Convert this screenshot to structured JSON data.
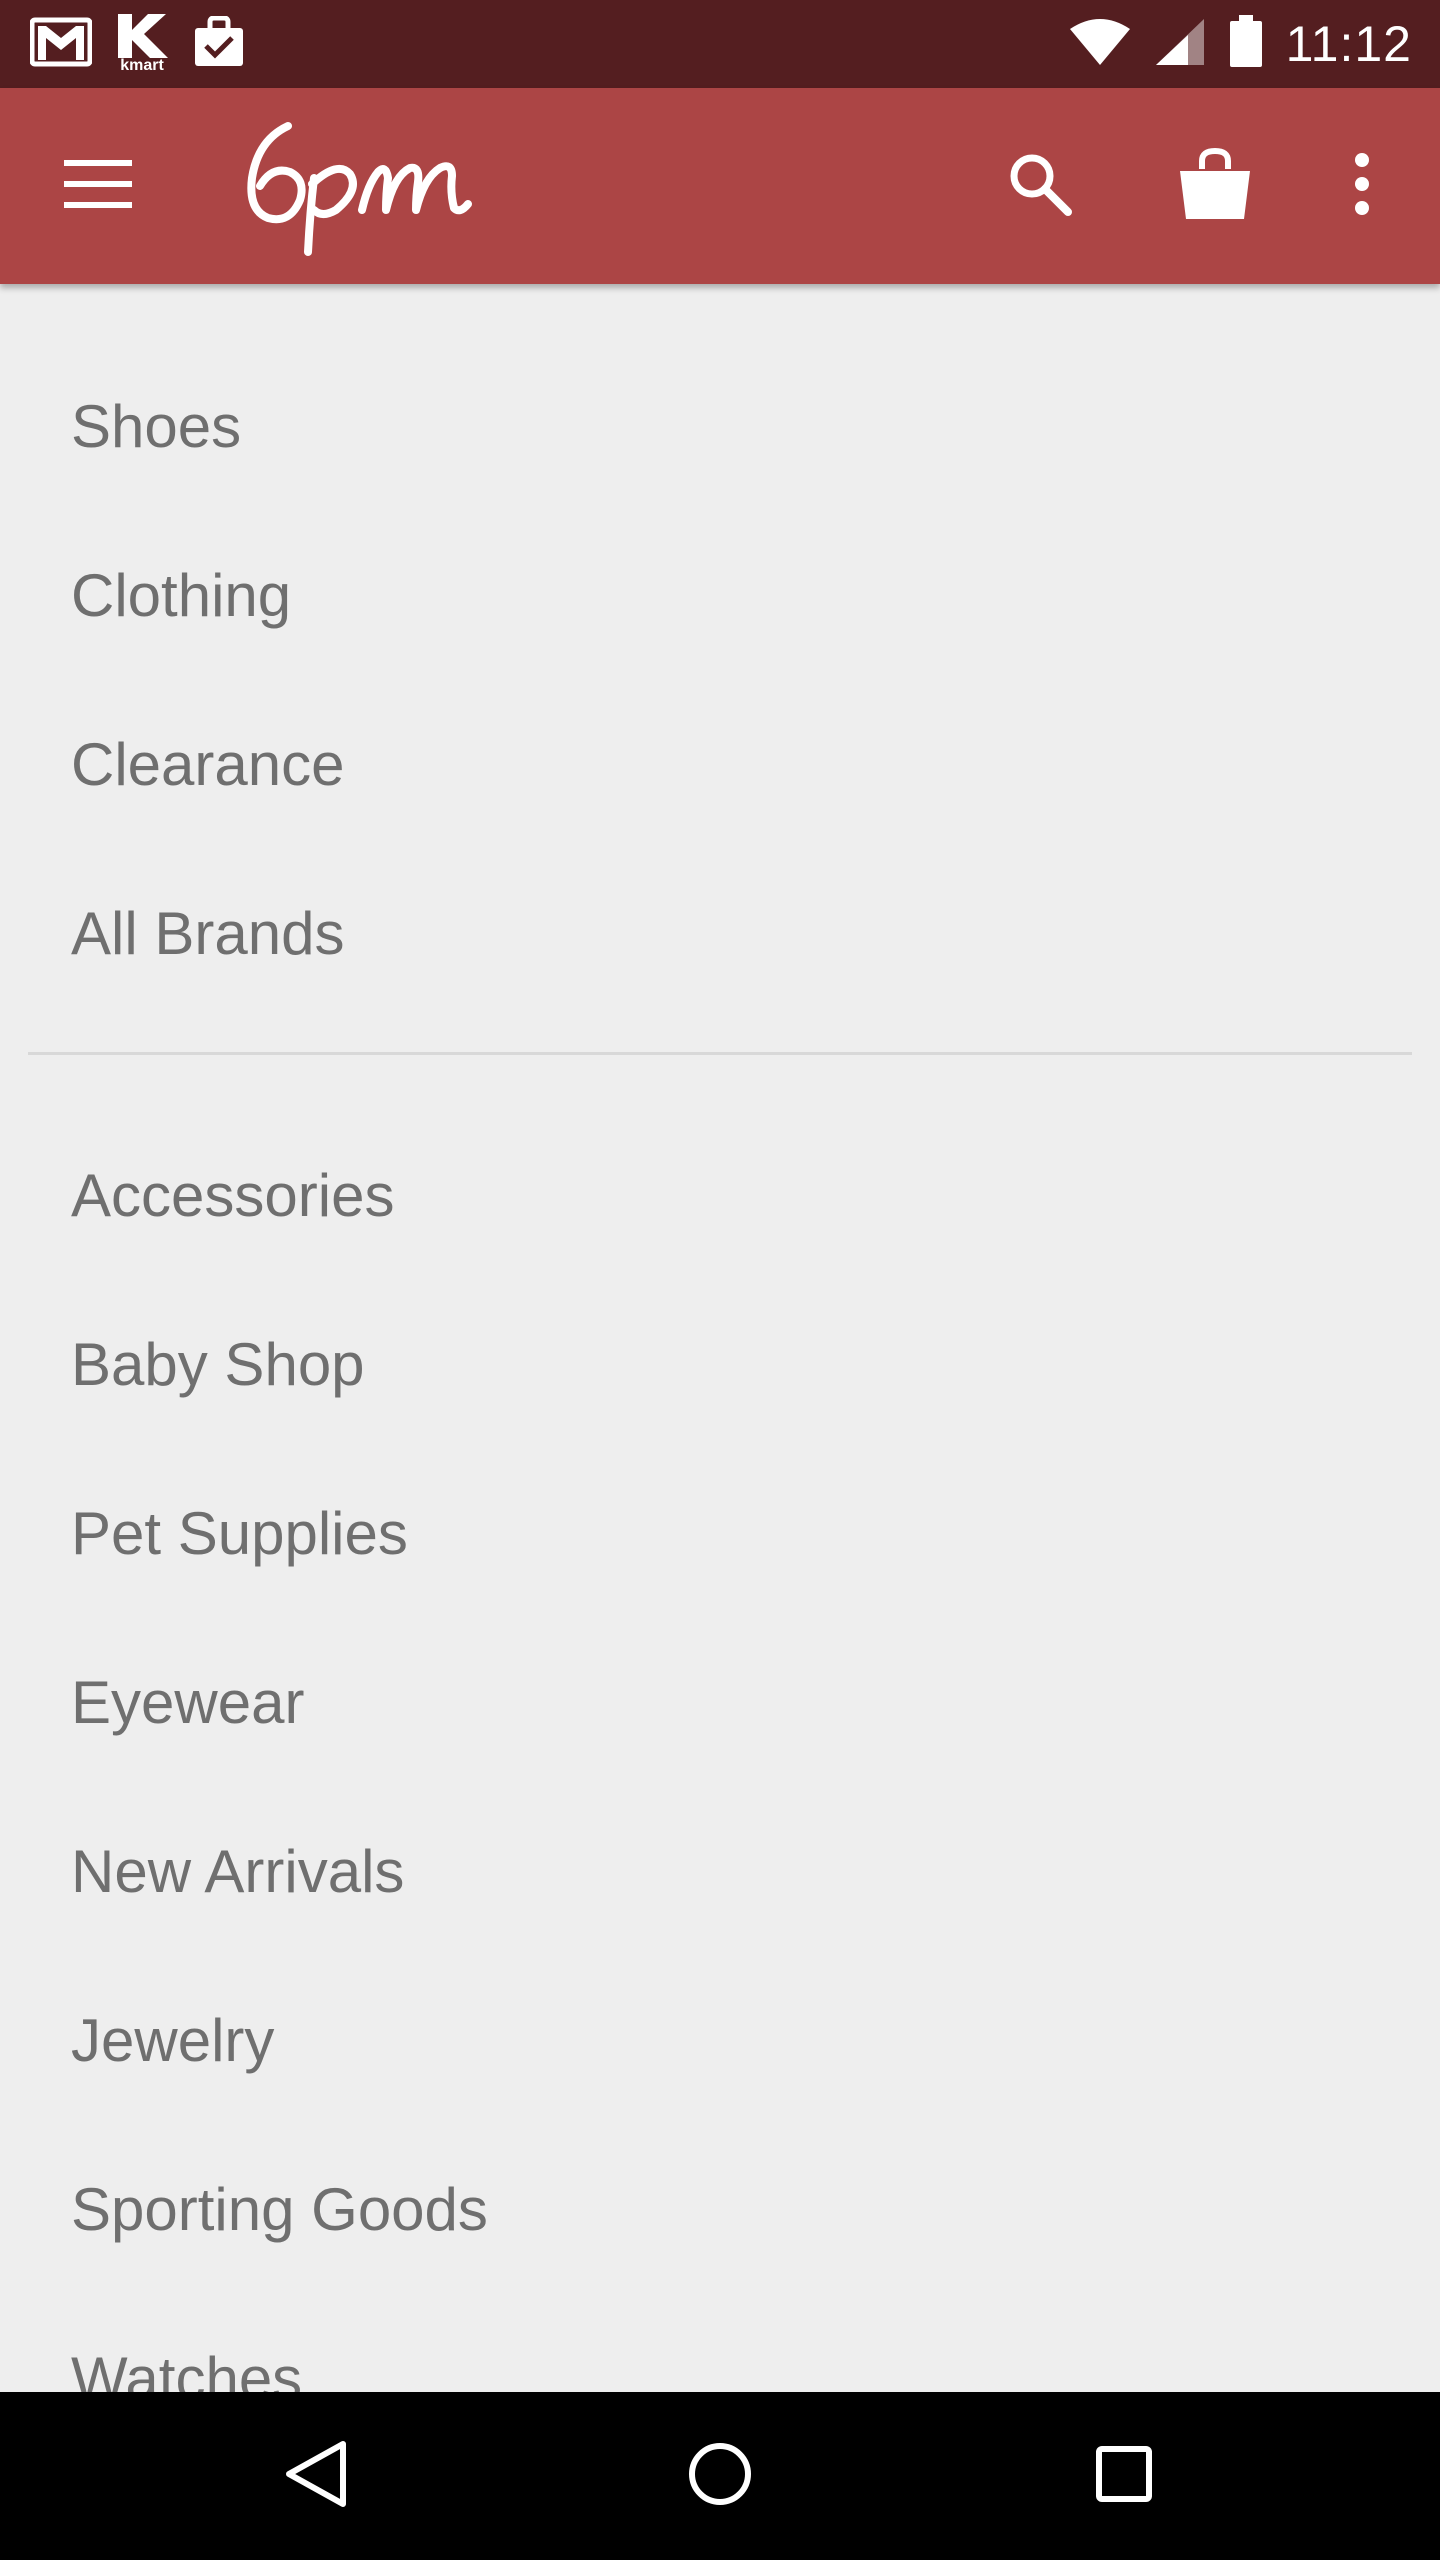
{
  "status_bar": {
    "time": "11:12",
    "left_icons": [
      "gmail-icon",
      "kmart-icon",
      "shopping-bag-check-icon"
    ],
    "kmart_text": "kmart",
    "right_icons": [
      "wifi-icon",
      "cell-signal-icon",
      "battery-icon"
    ]
  },
  "app_bar": {
    "logo_text": "6pm",
    "color": "#ac4545",
    "actions": [
      "menu-icon",
      "search-icon",
      "shopping-bag-icon",
      "more-vert-icon"
    ]
  },
  "menu": {
    "primary": [
      {
        "label": "Shoes"
      },
      {
        "label": "Clothing"
      },
      {
        "label": "Clearance"
      },
      {
        "label": "All Brands"
      }
    ],
    "secondary": [
      {
        "label": "Accessories"
      },
      {
        "label": "Baby Shop"
      },
      {
        "label": "Pet Supplies"
      },
      {
        "label": "Eyewear"
      },
      {
        "label": "New Arrivals"
      },
      {
        "label": "Jewelry"
      },
      {
        "label": "Sporting Goods"
      },
      {
        "label": "Watches"
      }
    ]
  },
  "nav_bar": {
    "buttons": [
      "back-icon",
      "home-icon",
      "recents-icon"
    ]
  },
  "colors": {
    "status_bar": "#541e20",
    "app_bar": "#ac4545",
    "background": "#eeeeee",
    "text": "#6f6f6f",
    "divider": "#d8d8d8"
  }
}
